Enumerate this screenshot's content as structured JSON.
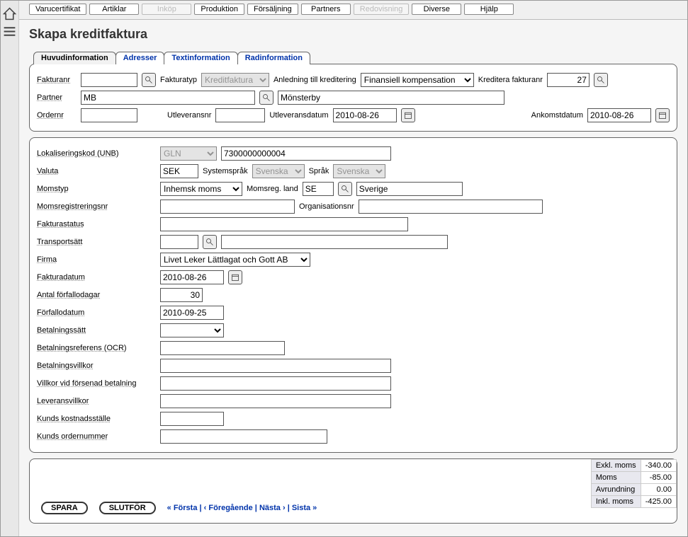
{
  "nav": {
    "items": [
      {
        "label": "Varucertifikat",
        "disabled": false
      },
      {
        "label": "Artiklar",
        "disabled": false
      },
      {
        "label": "Inköp",
        "disabled": true
      },
      {
        "label": "Produktion",
        "disabled": false
      },
      {
        "label": "Försäljning",
        "disabled": false
      },
      {
        "label": "Partners",
        "disabled": false
      },
      {
        "label": "Redovisning",
        "disabled": true
      },
      {
        "label": "Diverse",
        "disabled": false
      },
      {
        "label": "Hjälp",
        "disabled": false
      }
    ]
  },
  "page": {
    "title": "Skapa kreditfaktura"
  },
  "subtabs": [
    {
      "label": "Huvudinformation",
      "active": true
    },
    {
      "label": "Adresser",
      "active": false
    },
    {
      "label": "Textinformation",
      "active": false
    },
    {
      "label": "Radinformation",
      "active": false
    }
  ],
  "head": {
    "fakturanr_lbl": "Fakturanr",
    "fakturanr": "",
    "fakturatyp_lbl": "Fakturatyp",
    "fakturatyp": "Kreditfaktura",
    "anledning_lbl": "Anledning till kreditering",
    "anledning": "Finansiell kompensation",
    "kreditera_lbl": "Kreditera fakturanr",
    "kreditera": "27",
    "partner_lbl": "Partner",
    "partner_code": "MB",
    "partner_name": "Mönsterby",
    "ordernr_lbl": "Ordernr",
    "ordernr": "",
    "utleveransnr_lbl": "Utleveransnr",
    "utleveransnr": "",
    "utleveransdatum_lbl": "Utleveransdatum",
    "utleveransdatum": "2010-08-26",
    "ankomstdatum_lbl": "Ankomstdatum",
    "ankomstdatum": "2010-08-26"
  },
  "form": {
    "lokaliseringskod_lbl": "Lokaliseringskod (UNB)",
    "lokaliseringskod_sel": "GLN",
    "lokaliseringskod_val": "7300000000004",
    "valuta_lbl": "Valuta",
    "valuta": "SEK",
    "systemsprak_lbl": "Systemspråk",
    "systemsprak": "Svenska",
    "sprak_lbl": "Språk",
    "sprak": "Svenska",
    "momstyp_lbl": "Momstyp",
    "momstyp": "Inhemsk moms",
    "momsreg_land_lbl": "Momsreg. land",
    "momsreg_land": "SE",
    "momsreg_land_name": "Sverige",
    "momsregnr_lbl": "Momsregistreringsnr",
    "momsregnr": "",
    "orgnr_lbl": "Organisationsnr",
    "orgnr": "",
    "fakturastatus_lbl": "Fakturastatus",
    "fakturastatus": "",
    "transportsatt_lbl": "Transportsätt",
    "transportsatt_code": "",
    "transportsatt_name": "",
    "firma_lbl": "Firma",
    "firma": "Livet Leker Lättlagat och Gott AB",
    "fakturadatum_lbl": "Fakturadatum",
    "fakturadatum": "2010-08-26",
    "antal_forfallodagar_lbl": "Antal förfallodagar",
    "antal_forfallodagar": "30",
    "forfallodatum_lbl": "Förfallodatum",
    "forfallodatum": "2010-09-25",
    "betalningssatt_lbl": "Betalningssätt",
    "betalningssatt": "",
    "betalningsreferens_lbl": "Betalningsreferens (OCR)",
    "betalningsreferens": "",
    "betalningsvillkor_lbl": "Betalningsvillkor",
    "betalningsvillkor": "",
    "villkor_forsenad_lbl": "Villkor vid försenad betalning",
    "villkor_forsenad": "",
    "leveransvillkor_lbl": "Leveransvillkor",
    "leveransvillkor": "",
    "kunds_kostnadsstalle_lbl": "Kunds kostnadsställe",
    "kunds_kostnadsstalle": "",
    "kunds_ordernummer_lbl": "Kunds ordernummer",
    "kunds_ordernummer": ""
  },
  "totals": {
    "exkl_moms_lbl": "Exkl. moms",
    "exkl_moms": "-340.00",
    "moms_lbl": "Moms",
    "moms": "-85.00",
    "avrundning_lbl": "Avrundning",
    "avrundning": "0.00",
    "inkl_moms_lbl": "Inkl. moms",
    "inkl_moms": "-425.00"
  },
  "footer": {
    "spara": "SPARA",
    "slutfor": "SLUTFÖR",
    "first": "« Första",
    "prev": "‹ Föregående",
    "next": "Nästa ›",
    "last": "Sista »",
    "sep": " | "
  }
}
